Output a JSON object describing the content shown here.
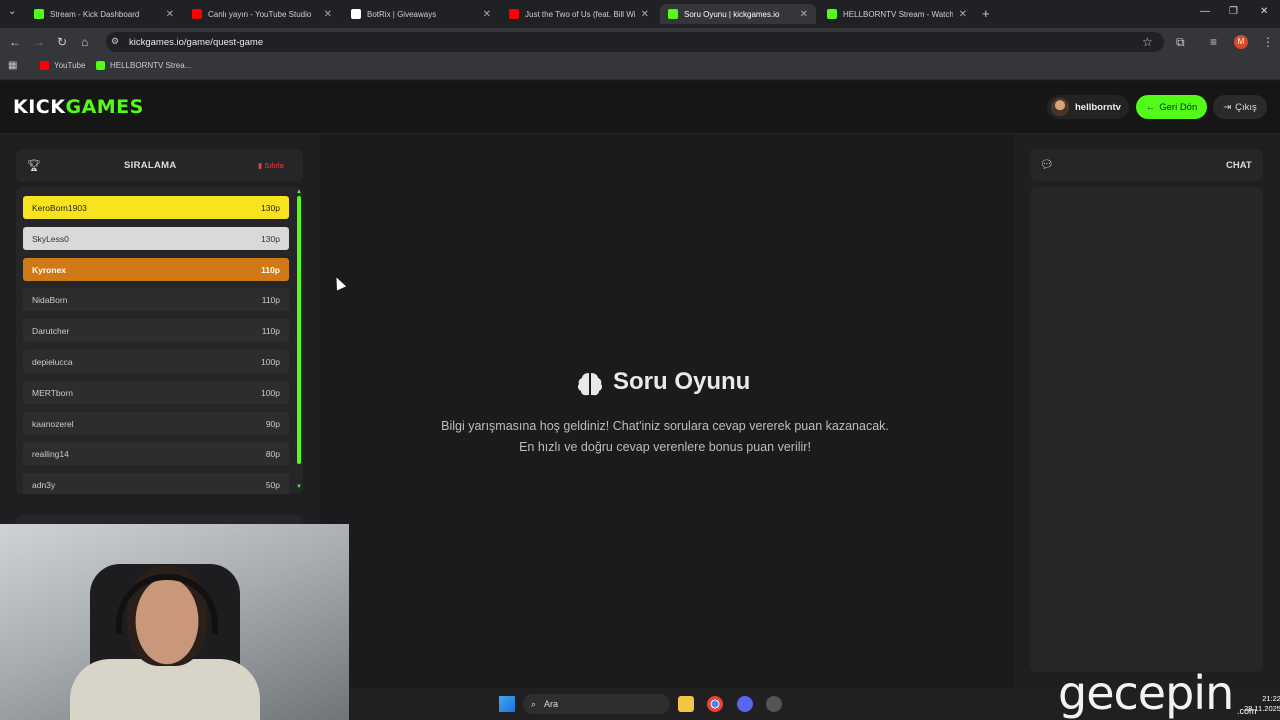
{
  "browser": {
    "tabs": [
      {
        "title": "Stream - Kick Dashboard",
        "favicon_color": "#53fc18",
        "active": false
      },
      {
        "title": "Canlı yayın - YouTube Studio",
        "favicon_color": "#ff0000",
        "active": false
      },
      {
        "title": "BotRix | Giveaways",
        "favicon_color": "#ffffff",
        "active": false
      },
      {
        "title": "Just the Two of Us (feat. Bill Wi...",
        "favicon_color": "#ff0000",
        "active": false
      },
      {
        "title": "Soru Oyunu | kickgames.io",
        "favicon_color": "#53fc18",
        "active": true
      },
      {
        "title": "HELLBORNTV Stream - Watch L...",
        "favicon_color": "#53fc18",
        "active": false
      }
    ],
    "url": "kickgames.io/game/quest-game",
    "bookmarks": [
      {
        "label": "YouTube",
        "favicon_color": "#ff0000"
      },
      {
        "label": "HELLBORNTV Strea...",
        "favicon_color": "#53fc18"
      }
    ],
    "profile_initial": "M"
  },
  "app": {
    "logo_kick": "KICK",
    "logo_games": "GAMES",
    "username": "hellborntv",
    "back_button": "Geri Dön",
    "exit_button": "Çıkış",
    "accent_color": "#53fc18"
  },
  "leaderboard": {
    "title": "SIRALAMA",
    "reset_label": "Sıfırla",
    "rows": [
      {
        "name": "KeroBorn1903",
        "points": "130p",
        "rank_style": "gold"
      },
      {
        "name": "SkyLess0",
        "points": "130p",
        "rank_style": "silver"
      },
      {
        "name": "Kyronex",
        "points": "110p",
        "rank_style": "bronze"
      },
      {
        "name": "NidaBorn",
        "points": "110p",
        "rank_style": "normal"
      },
      {
        "name": "Darutcher",
        "points": "110p",
        "rank_style": "normal"
      },
      {
        "name": "depielucca",
        "points": "100p",
        "rank_style": "normal"
      },
      {
        "name": "MERTborn",
        "points": "100p",
        "rank_style": "normal"
      },
      {
        "name": "kaanozerel",
        "points": "90p",
        "rank_style": "normal"
      },
      {
        "name": "realling14",
        "points": "80p",
        "rank_style": "normal"
      },
      {
        "name": "adn3y",
        "points": "50p",
        "rank_style": "normal"
      }
    ]
  },
  "game": {
    "title": "Soru Oyunu",
    "description": "Bilgi yarışmasına hoş geldiniz! Chat'iniz sorulara cevap vererek puan kazanacak. En hızlı ve doğru cevap verenlere bonus puan verilir!"
  },
  "chat": {
    "title": "CHAT"
  },
  "taskbar": {
    "search_label": "Ara",
    "time": "21:22",
    "date": "28.11.2025"
  },
  "watermark": {
    "text": "gecepin",
    "sub": ".com"
  }
}
